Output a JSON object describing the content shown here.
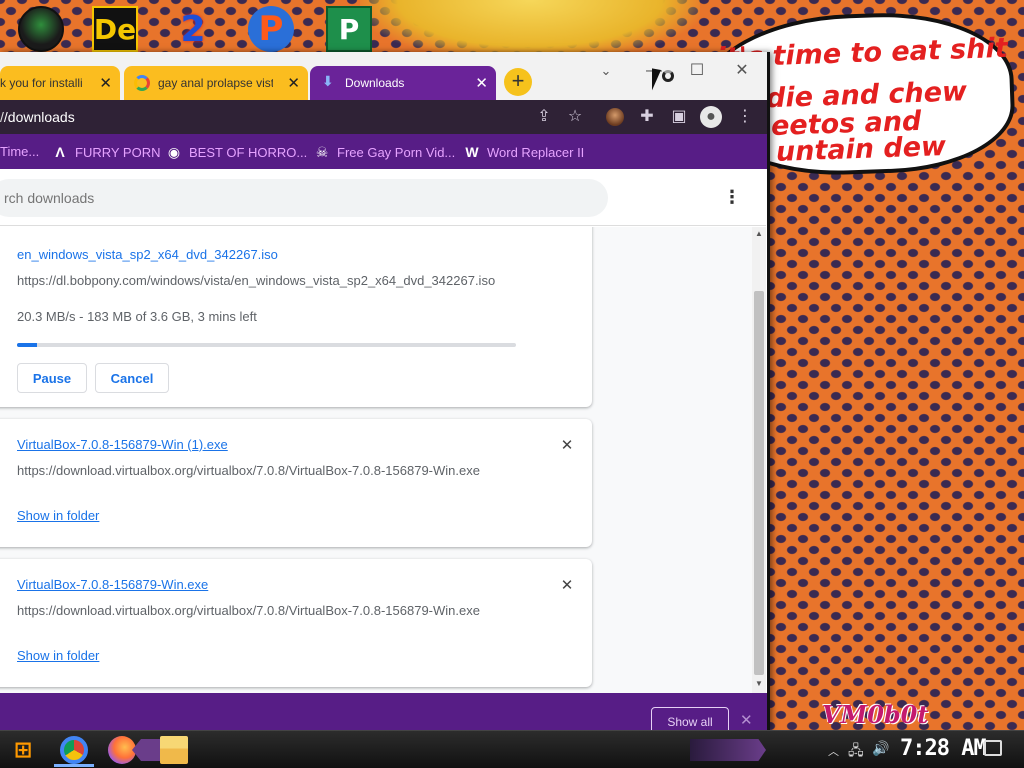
{
  "desktop": {
    "bubble_lines": [
      "it's time to eat shit",
      "die and chew",
      "eetos and",
      "untain dew"
    ],
    "watermark": "VM0b0t"
  },
  "browser": {
    "tabs": [
      {
        "label": "k you for installi",
        "active": false
      },
      {
        "label": "gay anal prolapse vista",
        "active": false
      },
      {
        "label": "Downloads",
        "active": true
      }
    ],
    "address": {
      "prefix": "/",
      "path": "/downloads"
    },
    "bookmarks": [
      {
        "label": "Time...",
        "icon": ""
      },
      {
        "label": "FURRY PORN",
        "icon": "Λ"
      },
      {
        "label": "BEST OF HORRO...",
        "icon": "◉"
      },
      {
        "label": "Free Gay Porn Vid...",
        "icon": "☠"
      },
      {
        "label": "Word Replacer II",
        "icon": "W"
      }
    ]
  },
  "downloads": {
    "search_placeholder": "rch downloads",
    "items": [
      {
        "filename": "en_windows_vista_sp2_x64_dvd_342267.iso",
        "url": "https://dl.bobpony.com/windows/vista/en_windows_vista_sp2_x64_dvd_342267.iso",
        "status": "20.3 MB/s - 183 MB of 3.6 GB, 3 mins left",
        "progress_fraction": 0.04,
        "pause_label": "Pause",
        "cancel_label": "Cancel"
      },
      {
        "filename": "VirtualBox-7.0.8-156879-Win (1).exe",
        "url": "https://download.virtualbox.org/virtualbox/7.0.8/VirtualBox-7.0.8-156879-Win.exe",
        "show_label": "Show in folder"
      },
      {
        "filename": "VirtualBox-7.0.8-156879-Win.exe",
        "url": "https://download.virtualbox.org/virtualbox/7.0.8/VirtualBox-7.0.8-156879-Win.exe",
        "show_label": "Show in folder"
      }
    ],
    "shelf": {
      "show_all_label": "Show all"
    }
  },
  "taskbar": {
    "clock": "7:28 AM"
  },
  "colors": {
    "accent_purple": "#571d86",
    "active_tab": "#6a2399",
    "inactive_tab": "#fbbd1f",
    "link_blue": "#1a73e8"
  }
}
